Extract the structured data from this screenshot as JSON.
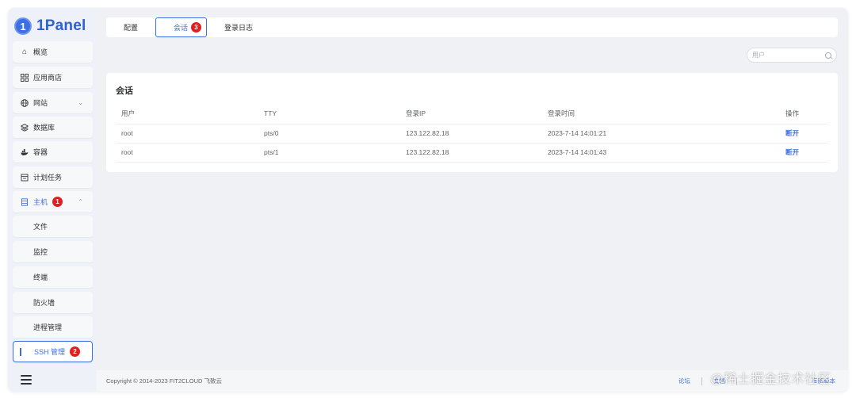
{
  "app": {
    "logo_mark": "1",
    "logo_text": "1Panel"
  },
  "sidebar": {
    "items": [
      {
        "label": "概览",
        "icon": "home-icon"
      },
      {
        "label": "应用商店",
        "icon": "apps-icon"
      },
      {
        "label": "网站",
        "icon": "globe-icon",
        "chevron": "⌄"
      },
      {
        "label": "数据库",
        "icon": "database-icon"
      },
      {
        "label": "容器",
        "icon": "docker-icon"
      },
      {
        "label": "计划任务",
        "icon": "calendar-icon"
      },
      {
        "label": "主机",
        "icon": "server-icon",
        "badge": "1",
        "chevron": "⌃"
      }
    ],
    "sub_items": [
      {
        "label": "文件"
      },
      {
        "label": "监控"
      },
      {
        "label": "终端"
      },
      {
        "label": "防火墙"
      },
      {
        "label": "进程管理"
      },
      {
        "label": "SSH 管理",
        "badge": "2"
      }
    ]
  },
  "tabs": [
    {
      "label": "配置"
    },
    {
      "label": "会话",
      "badge": "3"
    },
    {
      "label": "登录日志"
    }
  ],
  "search": {
    "placeholder": "用户"
  },
  "card": {
    "title": "会话",
    "columns": [
      "用户",
      "TTY",
      "登录IP",
      "登录时间",
      "操作"
    ],
    "rows": [
      {
        "user": "root",
        "tty": "pts/0",
        "ip": "123.122.82.18",
        "time": "2023-7-14 14:01:21",
        "action": "断开"
      },
      {
        "user": "root",
        "tty": "pts/1",
        "ip": "123.122.82.18",
        "time": "2023-7-14 14:01:43",
        "action": "断开"
      }
    ]
  },
  "footer": {
    "copyright": "Copyright © 2014-2023 FIT2CLOUD 飞致云",
    "link_forum": "论坛",
    "link_docs": "文档",
    "version_text": "有新版本"
  },
  "watermark": "@稀土掘金技术社区",
  "colors": {
    "accent": "#3d6fe0",
    "badge": "#e02020"
  }
}
